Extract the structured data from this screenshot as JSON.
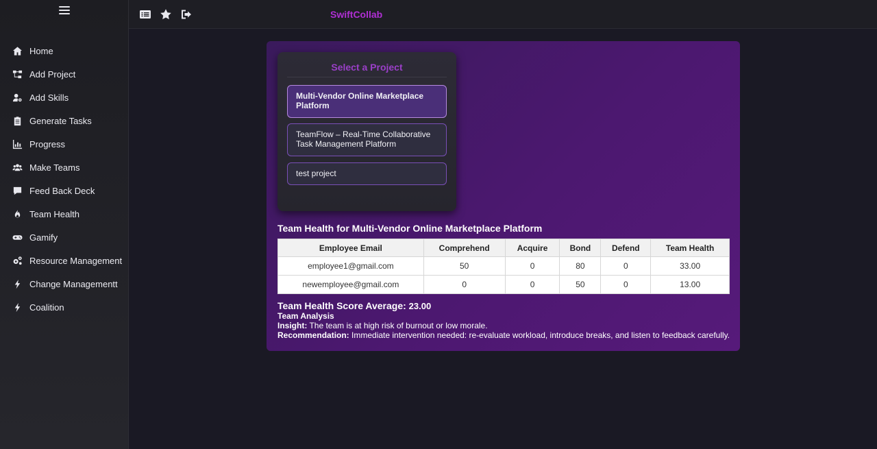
{
  "app": {
    "brand": "SwiftCollab"
  },
  "sidebar": {
    "items": [
      {
        "label": "Home",
        "icon": "home-icon"
      },
      {
        "label": "Add Project",
        "icon": "sitemap-icon"
      },
      {
        "label": "Add Skills",
        "icon": "user-gear-icon"
      },
      {
        "label": "Generate Tasks",
        "icon": "clipboard-icon"
      },
      {
        "label": "Progress",
        "icon": "bar-chart-icon"
      },
      {
        "label": "Make Teams",
        "icon": "users-icon"
      },
      {
        "label": "Feed Back Deck",
        "icon": "comment-icon"
      },
      {
        "label": "Team Health",
        "icon": "fire-icon"
      },
      {
        "label": "Gamify",
        "icon": "gamepad-icon"
      },
      {
        "label": "Resource Management",
        "icon": "cogs-icon"
      },
      {
        "label": "Change Managementt",
        "icon": "bolt-icon"
      },
      {
        "label": "Coalition",
        "icon": "bolt-icon"
      }
    ]
  },
  "topbar": {
    "icons": [
      "list-icon",
      "star-icon",
      "logout-icon"
    ]
  },
  "project_selector": {
    "title": "Select a Project",
    "projects": [
      {
        "name": "Multi-Vendor Online Marketplace Platform",
        "selected": true
      },
      {
        "name": "TeamFlow – Real-Time Collaborative Task Management Platform",
        "selected": false
      },
      {
        "name": "test project",
        "selected": false
      }
    ]
  },
  "team_health": {
    "heading": "Team Health for Multi-Vendor Online Marketplace Platform",
    "columns": [
      "Employee Email",
      "Comprehend",
      "Acquire",
      "Bond",
      "Defend",
      "Team Health"
    ],
    "rows": [
      [
        "employee1@gmail.com",
        "50",
        "0",
        "80",
        "0",
        "33.00"
      ],
      [
        "newemployee@gmail.com",
        "0",
        "0",
        "50",
        "0",
        "13.00"
      ]
    ],
    "average_label": "Team Health Score Average:",
    "average_value": "23.00",
    "analysis_title": "Team Analysis",
    "insight_label": "Insight:",
    "insight_text": "The team is at high risk of burnout or low morale.",
    "recommendation_label": "Recommendation:",
    "recommendation_text": "Immediate intervention needed: re-evaluate workload, introduce breaks, and listen to feedback carefully."
  },
  "colors": {
    "brand": "#b02fd4",
    "panel": "#4c1870",
    "card_title": "#9a3fc8",
    "selected_project": "#4a2f78"
  }
}
